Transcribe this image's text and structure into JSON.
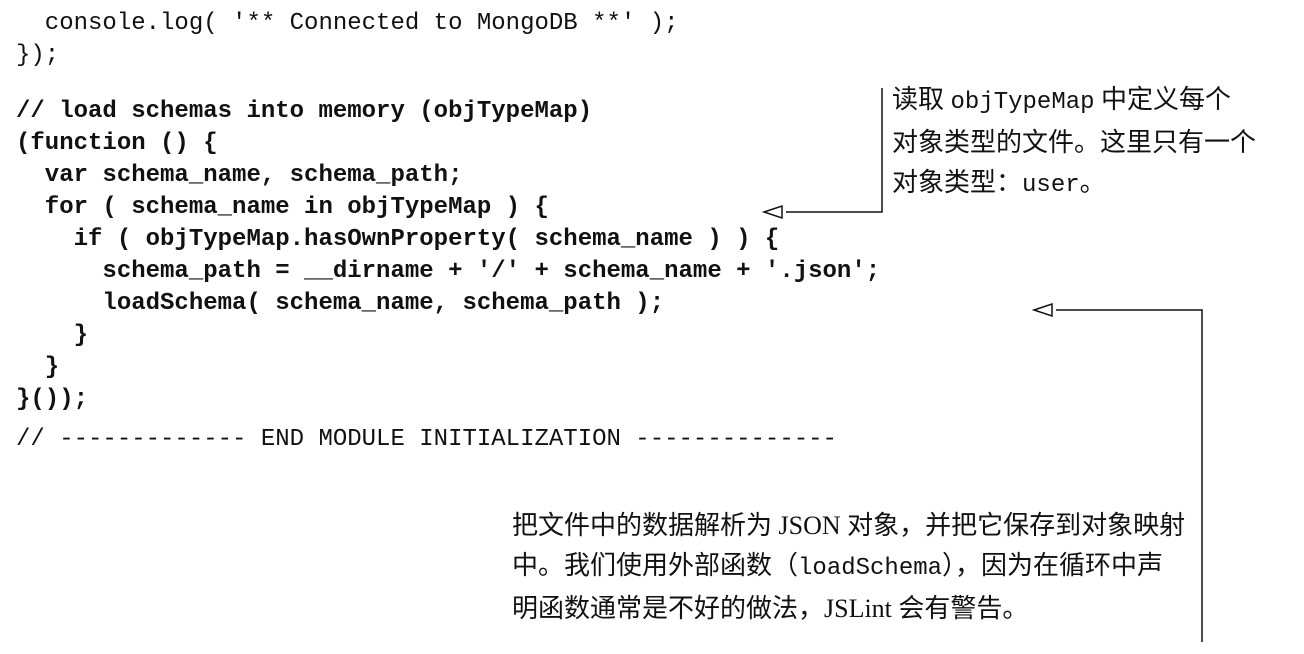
{
  "code_top": [
    "  console.log( '** Connected to MongoDB **' );",
    "});"
  ],
  "code_bold": [
    "// load schemas into memory (objTypeMap)",
    "(function () {",
    "  var schema_name, schema_path;",
    "  for ( schema_name in objTypeMap ) {",
    "    if ( objTypeMap.hasOwnProperty( schema_name ) ) {",
    "      schema_path = __dirname + '/' + schema_name + '.json';",
    "      loadSchema( schema_name, schema_path );",
    "    }",
    "  }",
    "}());"
  ],
  "code_bottom": [
    "// ------------- END MODULE INITIALIZATION --------------"
  ],
  "annotation_1": {
    "line1_prefix": "读取 ",
    "line1_code": "objTypeMap",
    "line1_suffix": " 中定义每个",
    "line2": "对象类型的文件。这里只有一个",
    "line3_prefix": "对象类型：",
    "line3_code": "user",
    "line3_suffix": "。"
  },
  "annotation_2": {
    "line1": "把文件中的数据解析为 JSON 对象，并把它保存到对象映射",
    "line2_prefix": "中。我们使用外部函数（",
    "line2_code": "loadSchema",
    "line2_suffix": "），因为在循环中声",
    "line3": "明函数通常是不好的做法，JSLint 会有警告。"
  }
}
